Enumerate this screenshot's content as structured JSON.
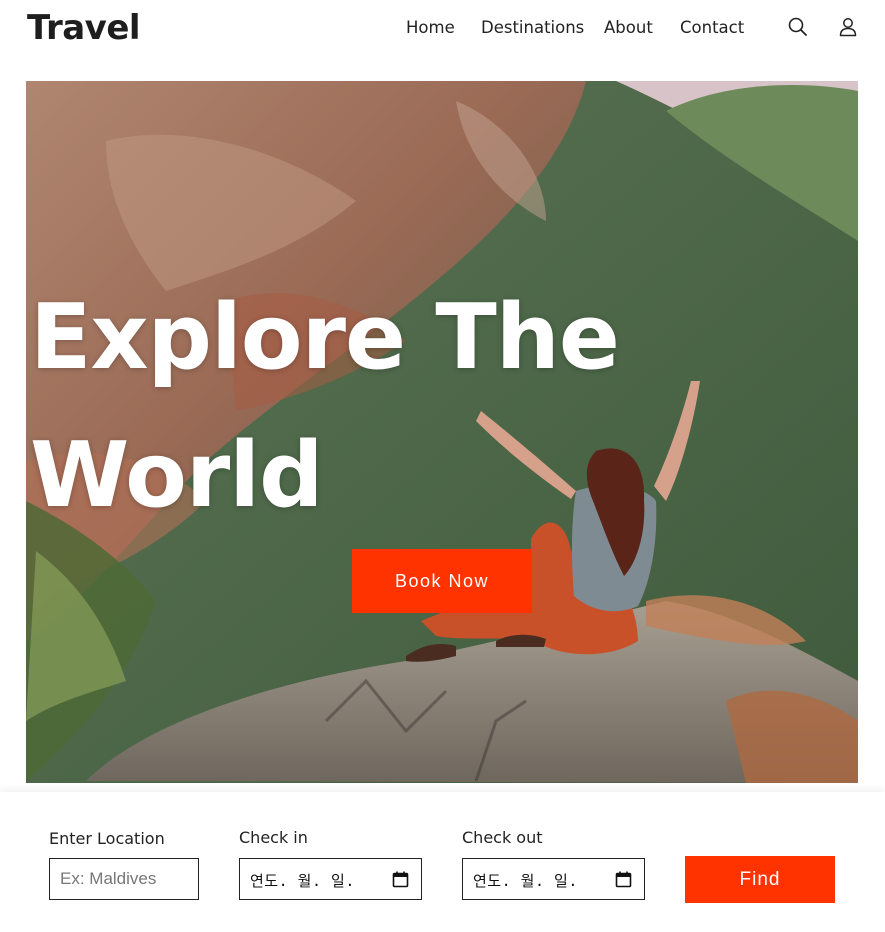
{
  "brand": {
    "logo": "Travel"
  },
  "nav": {
    "items": [
      {
        "label": "Home"
      },
      {
        "label": "Destinations"
      },
      {
        "label": "About"
      },
      {
        "label": "Contact"
      }
    ],
    "icons": [
      "search-icon",
      "user-icon"
    ]
  },
  "hero": {
    "title_line1": "Explore The",
    "title_line2": "World",
    "cta_label": "Book Now"
  },
  "booking": {
    "location_label": "Enter Location",
    "location_placeholder": "Ex: Maldives",
    "location_value": "",
    "checkin_label": "Check in",
    "checkin_value": "연도. 월. 일.",
    "checkout_label": "Check out",
    "checkout_value": "연도. 월. 일.",
    "find_label": "Find"
  },
  "colors": {
    "accent": "#ff3300",
    "text": "#222222",
    "background": "#ffffff"
  }
}
